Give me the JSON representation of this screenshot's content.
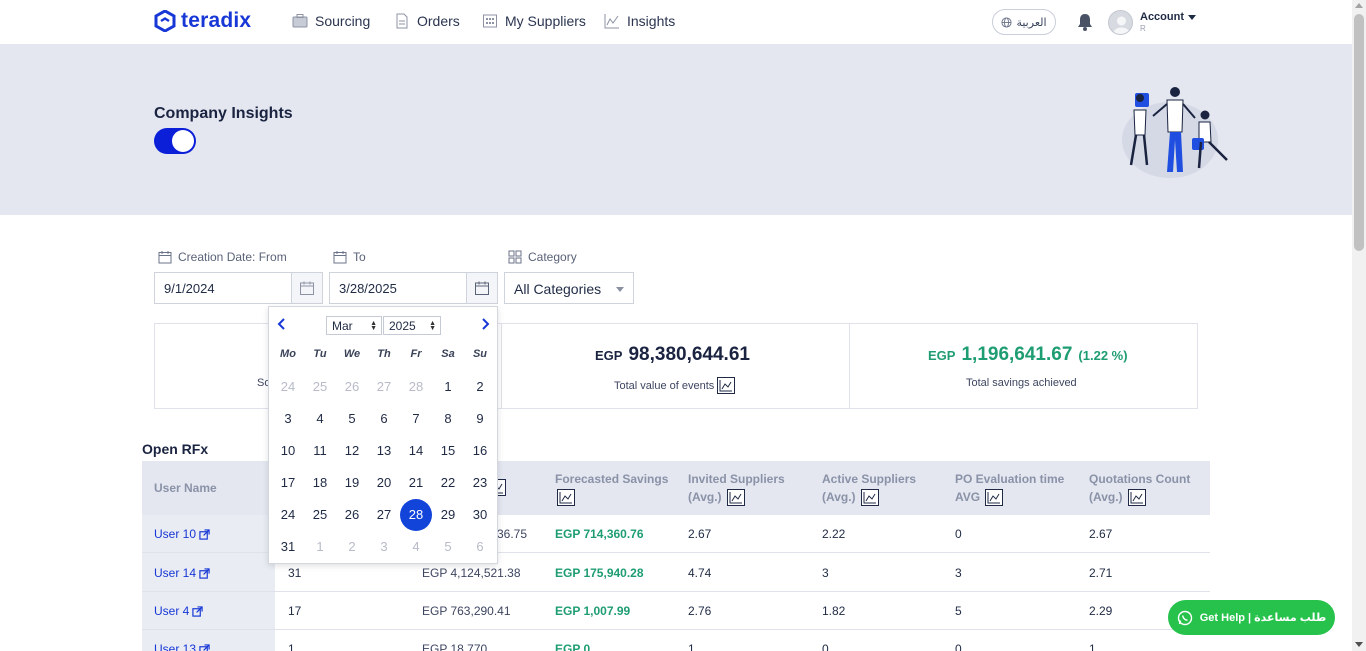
{
  "brand": {
    "name": "teradix",
    "color": "#1737d6"
  },
  "nav": {
    "items": [
      {
        "label": "Sourcing",
        "icon": "briefcase-icon"
      },
      {
        "label": "Orders",
        "icon": "document-icon"
      },
      {
        "label": "My Suppliers",
        "icon": "building-icon"
      },
      {
        "label": "Insights",
        "icon": "line-chart-icon"
      }
    ],
    "language": "العربية",
    "account_label": "Account",
    "account_sub": "R"
  },
  "banner": {
    "title": "Company Insights",
    "toggle_on": true
  },
  "filters": {
    "from_label": "Creation Date: From",
    "from_value": "9/1/2024",
    "to_label": "To",
    "to_value": "3/28/2025",
    "category_label": "Category",
    "category_value": "All Categories"
  },
  "calendar": {
    "month": "Mar",
    "year": "2025",
    "weekdays": [
      "Mo",
      "Tu",
      "We",
      "Th",
      "Fr",
      "Sa",
      "Su"
    ],
    "weeks": [
      [
        [
          "24",
          true
        ],
        [
          "25",
          true
        ],
        [
          "26",
          true
        ],
        [
          "27",
          true
        ],
        [
          "28",
          true
        ],
        [
          "1",
          false
        ],
        [
          "2",
          false
        ]
      ],
      [
        [
          "3",
          false
        ],
        [
          "4",
          false
        ],
        [
          "5",
          false
        ],
        [
          "6",
          false
        ],
        [
          "7",
          false
        ],
        [
          "8",
          false
        ],
        [
          "9",
          false
        ]
      ],
      [
        [
          "10",
          false
        ],
        [
          "11",
          false
        ],
        [
          "12",
          false
        ],
        [
          "13",
          false
        ],
        [
          "14",
          false
        ],
        [
          "15",
          false
        ],
        [
          "16",
          false
        ]
      ],
      [
        [
          "17",
          false
        ],
        [
          "18",
          false
        ],
        [
          "19",
          false
        ],
        [
          "20",
          false
        ],
        [
          "21",
          false
        ],
        [
          "22",
          false
        ],
        [
          "23",
          false
        ]
      ],
      [
        [
          "24",
          false
        ],
        [
          "25",
          false
        ],
        [
          "26",
          false
        ],
        [
          "27",
          false
        ],
        [
          "28",
          false
        ],
        [
          "29",
          false
        ],
        [
          "30",
          false
        ]
      ],
      [
        [
          "31",
          false
        ],
        [
          "1",
          true
        ],
        [
          "2",
          true
        ],
        [
          "3",
          true
        ],
        [
          "4",
          true
        ],
        [
          "5",
          true
        ],
        [
          "6",
          true
        ]
      ]
    ],
    "selected_day": "28"
  },
  "stats": {
    "card1_partial_label": "So",
    "total_value": {
      "currency": "EGP",
      "amount": "98,380,644.61",
      "label": "Total value of events"
    },
    "savings": {
      "currency": "EGP",
      "amount": "1,196,641.67",
      "pct": "(1.22 %)",
      "label": "Total savings achieved"
    },
    "colors": {
      "dark": "#1a2340",
      "green": "#1f9d72"
    }
  },
  "table": {
    "title": "Open RFx",
    "headers": {
      "user": "User Name",
      "forecasted": "Forecasted Savings",
      "invited": "Invited Suppliers",
      "invited_sub": "(Avg.)",
      "active": "Active Suppliers",
      "active_sub": "(Avg.)",
      "po": "PO Evaluation time",
      "po_sub": "AVG",
      "quotes": "Quotations Count",
      "quotes_sub": "(Avg.)"
    },
    "rows": [
      {
        "user": "User 10",
        "count": "",
        "value": "36.75",
        "forecast": "EGP 714,360.76",
        "invited": "2.67",
        "active": "2.22",
        "po": "0",
        "quotes": "2.67"
      },
      {
        "user": "User 14",
        "count": "31",
        "value": "EGP 4,124,521.38",
        "forecast": "EGP 175,940.28",
        "invited": "4.74",
        "active": "3",
        "po": "3",
        "quotes": "2.71"
      },
      {
        "user": "User 4",
        "count": "17",
        "value": "EGP 763,290.41",
        "forecast": "EGP 1,007.99",
        "invited": "2.76",
        "active": "1.82",
        "po": "5",
        "quotes": "2.29"
      },
      {
        "user": "User 13",
        "count": "1",
        "value": "EGP 18,770",
        "forecast": "EGP 0",
        "invited": "1",
        "active": "0",
        "po": "0",
        "quotes": "1"
      }
    ]
  },
  "help": {
    "label": "Get Help | طلب مساعدة"
  }
}
